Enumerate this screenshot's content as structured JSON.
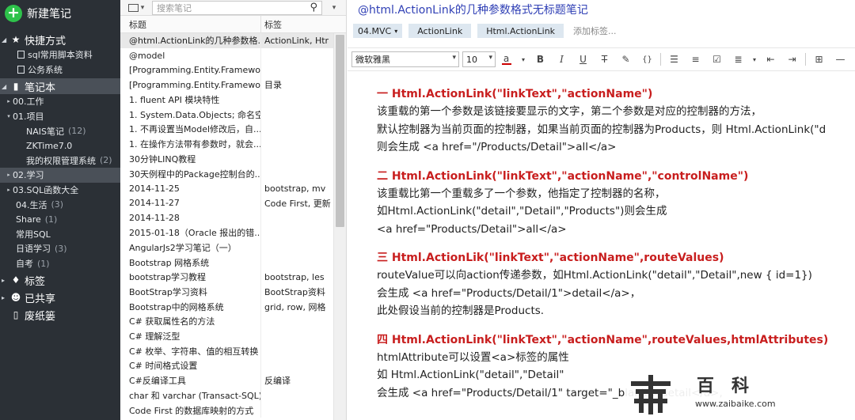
{
  "sidebar": {
    "new_note": "新建笔记",
    "shortcuts": {
      "label": "快捷方式",
      "items": [
        "sql常用脚本资料",
        "公务系统"
      ]
    },
    "notebooks_label": "笔记本",
    "tree": [
      {
        "label": "00.工作",
        "count": "",
        "indent": 0,
        "arrow": "▸"
      },
      {
        "label": "01.项目",
        "count": "",
        "indent": 0,
        "arrow": "▾"
      },
      {
        "label": "NAIS笔记",
        "count": "(12)",
        "indent": 2,
        "arrow": ""
      },
      {
        "label": "ZKTime7.0",
        "count": "",
        "indent": 2,
        "arrow": ""
      },
      {
        "label": "我的权限管理系统",
        "count": "(2)",
        "indent": 2,
        "arrow": ""
      },
      {
        "label": "02.学习",
        "count": "",
        "indent": 0,
        "arrow": "▸"
      },
      {
        "label": "03.SQL函数大全",
        "count": "",
        "indent": 0,
        "arrow": "▸"
      },
      {
        "label": "04.生活",
        "count": "(3)",
        "indent": 1,
        "arrow": ""
      },
      {
        "label": "Share",
        "count": "(1)",
        "indent": 1,
        "arrow": ""
      },
      {
        "label": "常用SQL",
        "count": "",
        "indent": 1,
        "arrow": ""
      },
      {
        "label": "日语学习",
        "count": "(3)",
        "indent": 1,
        "arrow": ""
      },
      {
        "label": "自考",
        "count": "(1)",
        "indent": 1,
        "arrow": ""
      }
    ],
    "tags_label": "标签",
    "shared_label": "已共享",
    "trash_label": "废纸篓"
  },
  "list": {
    "search_placeholder": "搜索笔记",
    "col_title": "标题",
    "col_tags": "标签",
    "rows": [
      {
        "title": "@html.ActionLink的几种参数格...",
        "tags": "ActionLink, Htr"
      },
      {
        "title": "@model",
        "tags": ""
      },
      {
        "title": "[Programming.Entity.Framewor...",
        "tags": ""
      },
      {
        "title": "[Programming.Entity.Framewor...",
        "tags": "目录"
      },
      {
        "title": "1. fluent API 模块特性",
        "tags": ""
      },
      {
        "title": "1. System.Data.Objects; 命名空...",
        "tags": ""
      },
      {
        "title": "1. 不再设置当Model修改后，自...",
        "tags": ""
      },
      {
        "title": "1. 在操作方法带有参数时，就会...",
        "tags": ""
      },
      {
        "title": "30分钟LINQ教程",
        "tags": ""
      },
      {
        "title": "30天例程中的Package控制台的...",
        "tags": ""
      },
      {
        "title": "2014-11-25",
        "tags": "bootstrap, mv"
      },
      {
        "title": "2014-11-27",
        "tags": "Code First, 更新"
      },
      {
        "title": "2014-11-28",
        "tags": ""
      },
      {
        "title": "2015-01-18（Oracle 报出的错...",
        "tags": ""
      },
      {
        "title": "AngularJs2学习笔记（一）",
        "tags": ""
      },
      {
        "title": "Bootstrap 网格系统",
        "tags": ""
      },
      {
        "title": "bootstrap学习教程",
        "tags": "bootstrap, les"
      },
      {
        "title": "BootStrap学习资料",
        "tags": "BootStrap资料"
      },
      {
        "title": "Bootstrap中的网格系统",
        "tags": "grid, row, 网格"
      },
      {
        "title": "C# 获取属性名的方法",
        "tags": ""
      },
      {
        "title": "C# 理解泛型",
        "tags": ""
      },
      {
        "title": "C# 枚举、字符串、值的相互转换",
        "tags": ""
      },
      {
        "title": "C# 时间格式设置",
        "tags": ""
      },
      {
        "title": "C#反编译工具",
        "tags": "反编译"
      },
      {
        "title": "char 和 varchar (Transact-SQL)",
        "tags": ""
      },
      {
        "title": "Code First 的数据库映射的方式",
        "tags": ""
      }
    ]
  },
  "editor": {
    "title": "@html.ActionLink的几种参数格式无标题笔记",
    "notebook": "04.MVC",
    "tags": [
      "ActionLink",
      "Html.ActionLink"
    ],
    "add_tag": "添加标签...",
    "font": "微软雅黑",
    "size": "10",
    "blocks": [
      {
        "heading": "一 Html.ActionLink(\"linkText\",\"actionName\")",
        "lines": [
          "该重载的第一个参数是该链接要显示的文字，第二个参数是对应的控制器的方法，",
          "默认控制器为当前页面的控制器，如果当前页面的控制器为Products，则 Html.ActionLink(\"d",
          "则会生成 <a href=\"/Products/Detail\">all</a>"
        ]
      },
      {
        "heading": "二 Html.ActionLink(\"linkText\",\"actionName\",\"controlName\")",
        "lines": [
          "该重载比第一个重载多了一个参数，他指定了控制器的名称，",
          "如Html.ActionLink(\"detail\",\"Detail\",\"Products\")则会生成",
          "<a href=\"Products/Detail\">all</a>"
        ]
      },
      {
        "heading": "三 Html.ActionLik(\"linkText\",\"actionName\",routeValues)",
        "lines": [
          "routeValue可以向action传递参数，如Html.ActionLink(\"detail\",\"Detail\",new { id=1})",
          "会生成 <a href=\"Products/Detail/1\">detail</a>，",
          "此处假设当前的控制器是Products."
        ]
      },
      {
        "heading": "四 Html.ActionLink(\"linkText\",\"actionName\",routeValues,htmlAttributes)",
        "lines": [
          "htmlAttribute可以设置<a>标签的属性",
          "如 Html.ActionLink(\"detail\",\"Detail\"",
          "会生成 <a href=\"Products/Detail/1\" target=\"_blank\">detail</a>,"
        ]
      }
    ]
  },
  "watermark": {
    "name": "百科",
    "url": "www.zaibaike.com"
  }
}
